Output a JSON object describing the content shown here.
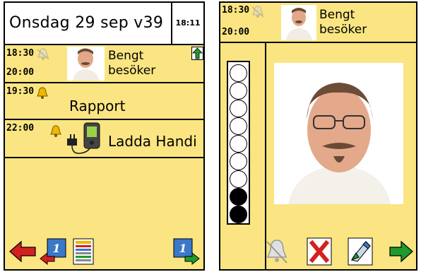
{
  "left_panel": {
    "date": "Onsdag 29 sep v39",
    "clock": "18:11",
    "events": [
      {
        "start": "18:30",
        "end": "20:00",
        "title_line1": "Bengt",
        "title_line2": "besöker"
      },
      {
        "start": "19:30",
        "title": "Rapport"
      },
      {
        "start": "22:00",
        "title": "Ladda Handi"
      }
    ]
  },
  "right_panel": {
    "start": "18:30",
    "end": "20:00",
    "title_line1": "Bengt",
    "title_line2": "besöker",
    "progress": {
      "total": 9,
      "filled": 2
    }
  },
  "colors": {
    "background": "#fae582",
    "red": "#d42020",
    "green": "#1e9b2a",
    "blue": "#3a78c8"
  },
  "icons": {
    "left_toolbar": [
      "arrow-left-icon",
      "back-to-day-icon",
      "list-view-icon",
      "forward-to-day-icon"
    ],
    "right_toolbar": [
      "alarm-bell-icon",
      "delete-x-icon",
      "edit-pencil-icon",
      "arrow-right-icon"
    ]
  }
}
